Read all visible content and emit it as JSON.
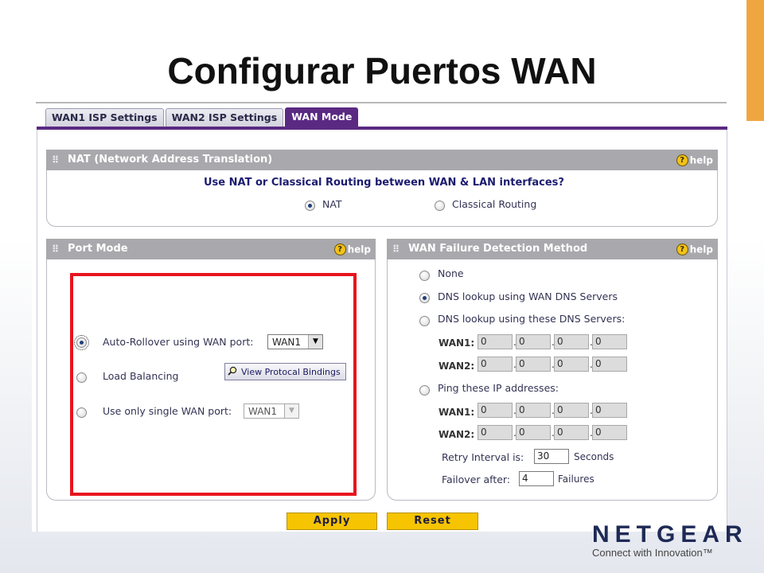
{
  "slide": {
    "title": "Configurar Puertos WAN"
  },
  "tabs": [
    {
      "label": "WAN1 ISP Settings",
      "active": false
    },
    {
      "label": "WAN2 ISP Settings",
      "active": false
    },
    {
      "label": "WAN Mode",
      "active": true
    }
  ],
  "help_label": "help",
  "nat_section": {
    "title": "NAT (Network Address Translation)",
    "question": "Use NAT or Classical Routing between WAN & LAN interfaces?",
    "options": [
      {
        "label": "NAT",
        "selected": true
      },
      {
        "label": "Classical Routing",
        "selected": false
      }
    ]
  },
  "port_mode": {
    "title": "Port Mode",
    "auto_rollover": {
      "label": "Auto-Rollover using WAN port:",
      "value": "WAN1",
      "selected": true
    },
    "load_balancing": {
      "label": "Load Balancing",
      "selected": false,
      "button_label": "View Protocal Bindings"
    },
    "single_wan": {
      "label": "Use only single WAN port:",
      "value": "WAN1",
      "selected": false
    }
  },
  "failure_detection": {
    "title": "WAN Failure Detection Method",
    "options": [
      {
        "label": "None",
        "selected": false
      },
      {
        "label": "DNS lookup using WAN DNS Servers",
        "selected": true
      },
      {
        "label": "DNS lookup using these DNS Servers:",
        "selected": false
      },
      {
        "label": "Ping these IP addresses:",
        "selected": false
      }
    ],
    "dns_servers": [
      {
        "label": "WAN1:",
        "octets": [
          "0",
          "0",
          "0",
          "0"
        ]
      },
      {
        "label": "WAN2:",
        "octets": [
          "0",
          "0",
          "0",
          "0"
        ]
      }
    ],
    "ping_addresses": [
      {
        "label": "WAN1:",
        "octets": [
          "0",
          "0",
          "0",
          "0"
        ]
      },
      {
        "label": "WAN2:",
        "octets": [
          "0",
          "0",
          "0",
          "0"
        ]
      }
    ],
    "retry": {
      "label": "Retry Interval is:",
      "value": "30",
      "unit": "Seconds"
    },
    "failover": {
      "label": "Failover after:",
      "value": "4",
      "unit": "Failures"
    }
  },
  "buttons": {
    "apply": "Apply",
    "reset": "Reset"
  },
  "logo": {
    "name": "NETGEAR",
    "tagline": "Connect with Innovation™"
  },
  "colors": {
    "accent": "#5a2a82",
    "highlight": "#e8141e",
    "button": "#f6c400",
    "orange": "#f0a640"
  }
}
